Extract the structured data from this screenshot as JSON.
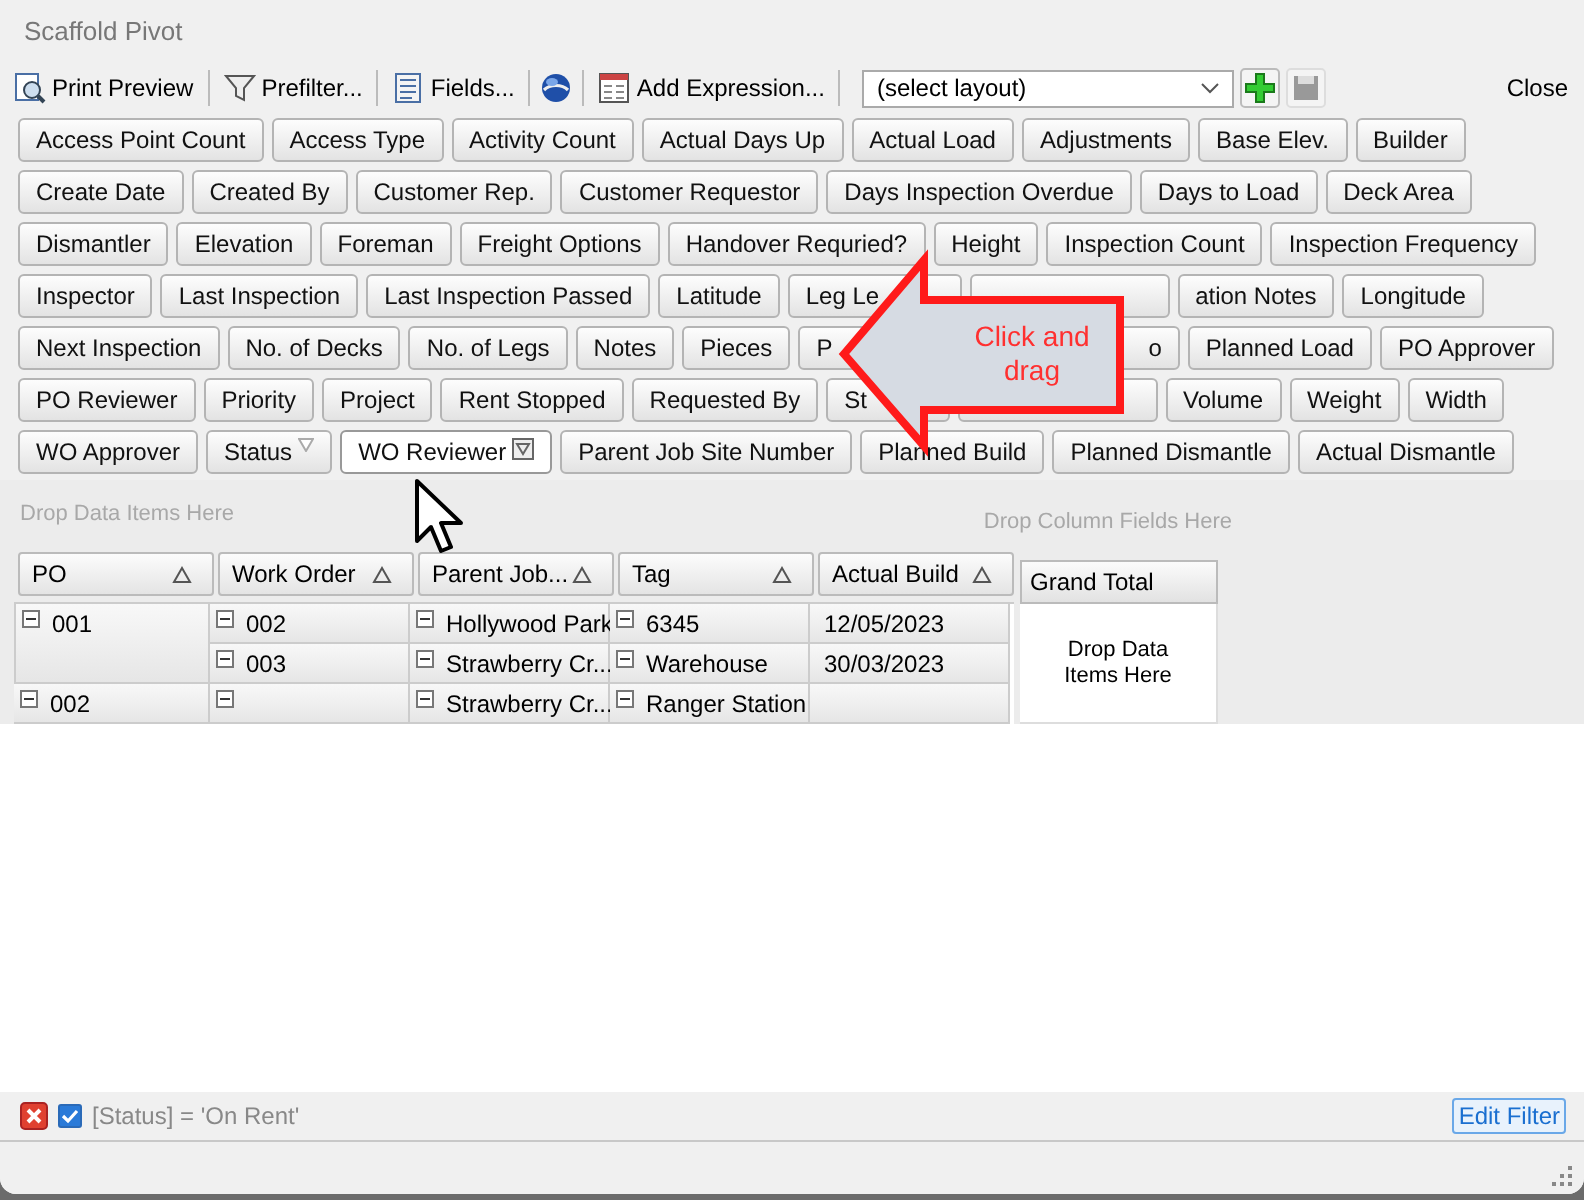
{
  "window": {
    "title": "Scaffold Pivot"
  },
  "toolbar": {
    "items": [
      {
        "kind": "print",
        "label": "Print Preview"
      },
      {
        "kind": "filter",
        "label": "Prefilter..."
      },
      {
        "kind": "fields",
        "label": "Fields..."
      },
      {
        "kind": "globe"
      },
      {
        "kind": "expression",
        "label": "Add Expression..."
      }
    ],
    "layout_select": {
      "value": "(select layout)"
    },
    "close": "Close"
  },
  "field_rows": [
    [
      {
        "label": "Access Point Count"
      },
      {
        "label": "Access Type"
      },
      {
        "label": "Activity Count"
      },
      {
        "label": "Actual Days Up"
      },
      {
        "label": "Actual Load"
      },
      {
        "label": "Adjustments"
      },
      {
        "label": "Base Elev."
      },
      {
        "label": "Builder"
      }
    ],
    [
      {
        "label": "Create Date"
      },
      {
        "label": "Created By"
      },
      {
        "label": "Customer Rep."
      },
      {
        "label": "Customer Requestor"
      },
      {
        "label": "Days Inspection Overdue"
      },
      {
        "label": "Days to Load"
      },
      {
        "label": "Deck Area"
      }
    ],
    [
      {
        "label": "Dismantler"
      },
      {
        "label": "Elevation"
      },
      {
        "label": "Foreman"
      },
      {
        "label": "Freight Options"
      },
      {
        "label": "Handover Requried?"
      },
      {
        "label": "Height"
      },
      {
        "label": "Inspection Count"
      },
      {
        "label": "Inspection Frequency"
      }
    ],
    [
      {
        "label": "Inspector"
      },
      {
        "label": "Last Inspection"
      },
      {
        "label": "Last Inspection Passed"
      },
      {
        "label": "Latitude"
      },
      {
        "label": "Leg Le",
        "kind": "cut_right"
      },
      {
        "kind": "covered"
      },
      {
        "label": "ation Notes"
      },
      {
        "label": "Longitude"
      }
    ],
    [
      {
        "label": "Next Inspection"
      },
      {
        "label": "No. of Decks"
      },
      {
        "label": "No. of Legs"
      },
      {
        "label": "Notes"
      },
      {
        "label": "Pieces"
      },
      {
        "label": "P",
        "kind": "cut_right"
      },
      {
        "label": "o",
        "kind": "cut_left"
      },
      {
        "label": "Planned Load"
      },
      {
        "label": "PO Approver"
      }
    ],
    [
      {
        "label": "PO Reviewer"
      },
      {
        "label": "Priority"
      },
      {
        "label": "Project"
      },
      {
        "label": "Rent Stopped"
      },
      {
        "label": "Requested By"
      },
      {
        "label": "St",
        "kind": "cut_right"
      },
      {
        "kind": "covered"
      },
      {
        "label": "Volume"
      },
      {
        "label": "Weight"
      },
      {
        "label": "Width"
      }
    ],
    [
      {
        "label": "WO Approver"
      },
      {
        "label": "Status",
        "has_filter": true,
        "filter_applied": false,
        "highlighted": false
      },
      {
        "label": "WO Reviewer",
        "has_filter": true,
        "filter_applied": true,
        "highlighted": true
      },
      {
        "label": "Parent Job Site Number"
      },
      {
        "label": "Planned Build"
      },
      {
        "label": "Planned Dismantle"
      },
      {
        "label": "Actual Dismantle"
      }
    ]
  ],
  "callout": {
    "text": "Click and drag"
  },
  "data_area": {
    "placeholder": "Drop Data Items Here"
  },
  "column_area": {
    "placeholder": "Drop Column Fields Here"
  },
  "pivot": {
    "row_fields": [
      {
        "label": "PO",
        "sort_ascending": true
      },
      {
        "label": "Work Order",
        "sort_ascending": true
      },
      {
        "label": "Parent Job...",
        "sort_ascending": true
      },
      {
        "label": "Tag",
        "sort_ascending": true
      },
      {
        "label": "Actual Build",
        "sort_ascending": true
      }
    ],
    "groups": [
      {
        "po": {
          "text": "001",
          "expanded": true
        },
        "rows": [
          [
            {
              "text": "002",
              "expanded": true
            },
            {
              "text": "Hollywood Park",
              "expanded": true
            },
            {
              "text": "6345",
              "expanded": true
            },
            {
              "text": "12/05/2023"
            }
          ],
          [
            {
              "text": "003",
              "expanded": true
            },
            {
              "text": "Strawberry Cr...",
              "expanded": true
            },
            {
              "text": "Warehouse",
              "expanded": true
            },
            {
              "text": "30/03/2023"
            }
          ]
        ]
      },
      {
        "po": {
          "text": "002",
          "expanded": true
        },
        "rows": [
          [
            {
              "expanded": true
            },
            {
              "text": "Strawberry Cr...",
              "expanded": true
            },
            {
              "text": "Ranger Station",
              "expanded": true
            },
            {}
          ]
        ]
      }
    ],
    "grand_total": {
      "header": "Grand Total",
      "placeholder": "Drop Data Items Here"
    }
  },
  "filter_bar": {
    "enabled": true,
    "expression": "[Status] = 'On Rent'",
    "edit": "Edit Filter"
  }
}
